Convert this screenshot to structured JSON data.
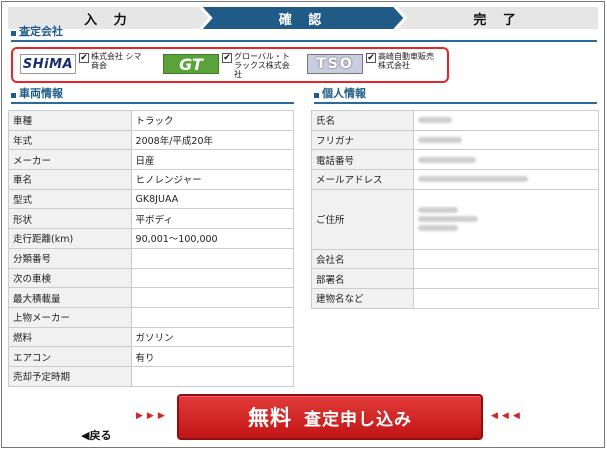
{
  "steps": [
    "入 力",
    "確 認",
    "完 了"
  ],
  "companies_section": {
    "title": "査定会社",
    "items": [
      {
        "logo": "SHiMA",
        "name": "株式会社 シマ商会",
        "checked": true
      },
      {
        "logo": "GT",
        "name": "グローバル・トラックス株式会社",
        "checked": true
      },
      {
        "logo": "TSO",
        "name": "高崎自動車販売株式会社",
        "checked": true
      }
    ]
  },
  "vehicle_section": {
    "title": "車両情報",
    "rows": [
      {
        "label": "車種",
        "value": "トラック"
      },
      {
        "label": "年式",
        "value": "2008年/平成20年"
      },
      {
        "label": "メーカー",
        "value": "日産"
      },
      {
        "label": "車名",
        "value": "ヒノレンジャー"
      },
      {
        "label": "型式",
        "value": "GK8JUAA"
      },
      {
        "label": "形状",
        "value": "平ボディ"
      },
      {
        "label": "走行距離(km)",
        "value": "90,001～100,000"
      },
      {
        "label": "分類番号",
        "value": ""
      },
      {
        "label": "次の車検",
        "value": ""
      },
      {
        "label": "最大積載量",
        "value": ""
      },
      {
        "label": "上物メーカー",
        "value": ""
      },
      {
        "label": "燃料",
        "value": "ガソリン"
      },
      {
        "label": "エアコン",
        "value": "有り"
      },
      {
        "label": "売却予定時期",
        "value": ""
      }
    ]
  },
  "personal_section": {
    "title": "個人情報",
    "rows": [
      {
        "label": "氏名"
      },
      {
        "label": "フリガナ"
      },
      {
        "label": "電話番号"
      },
      {
        "label": "メールアドレス"
      },
      {
        "label": "ご住所"
      },
      {
        "label": "会社名"
      },
      {
        "label": "部署名"
      },
      {
        "label": "建物名など"
      }
    ]
  },
  "submit": {
    "label_big": "無料",
    "label": "査定申し込み"
  },
  "back": {
    "label": "◀戻る"
  },
  "arrows": {
    "left": "▶▶▶",
    "right": "◀◀◀"
  },
  "colors": {
    "accent_blue": "#1f5b86",
    "highlight_red": "#e5252c",
    "button_red": "#c11515"
  }
}
